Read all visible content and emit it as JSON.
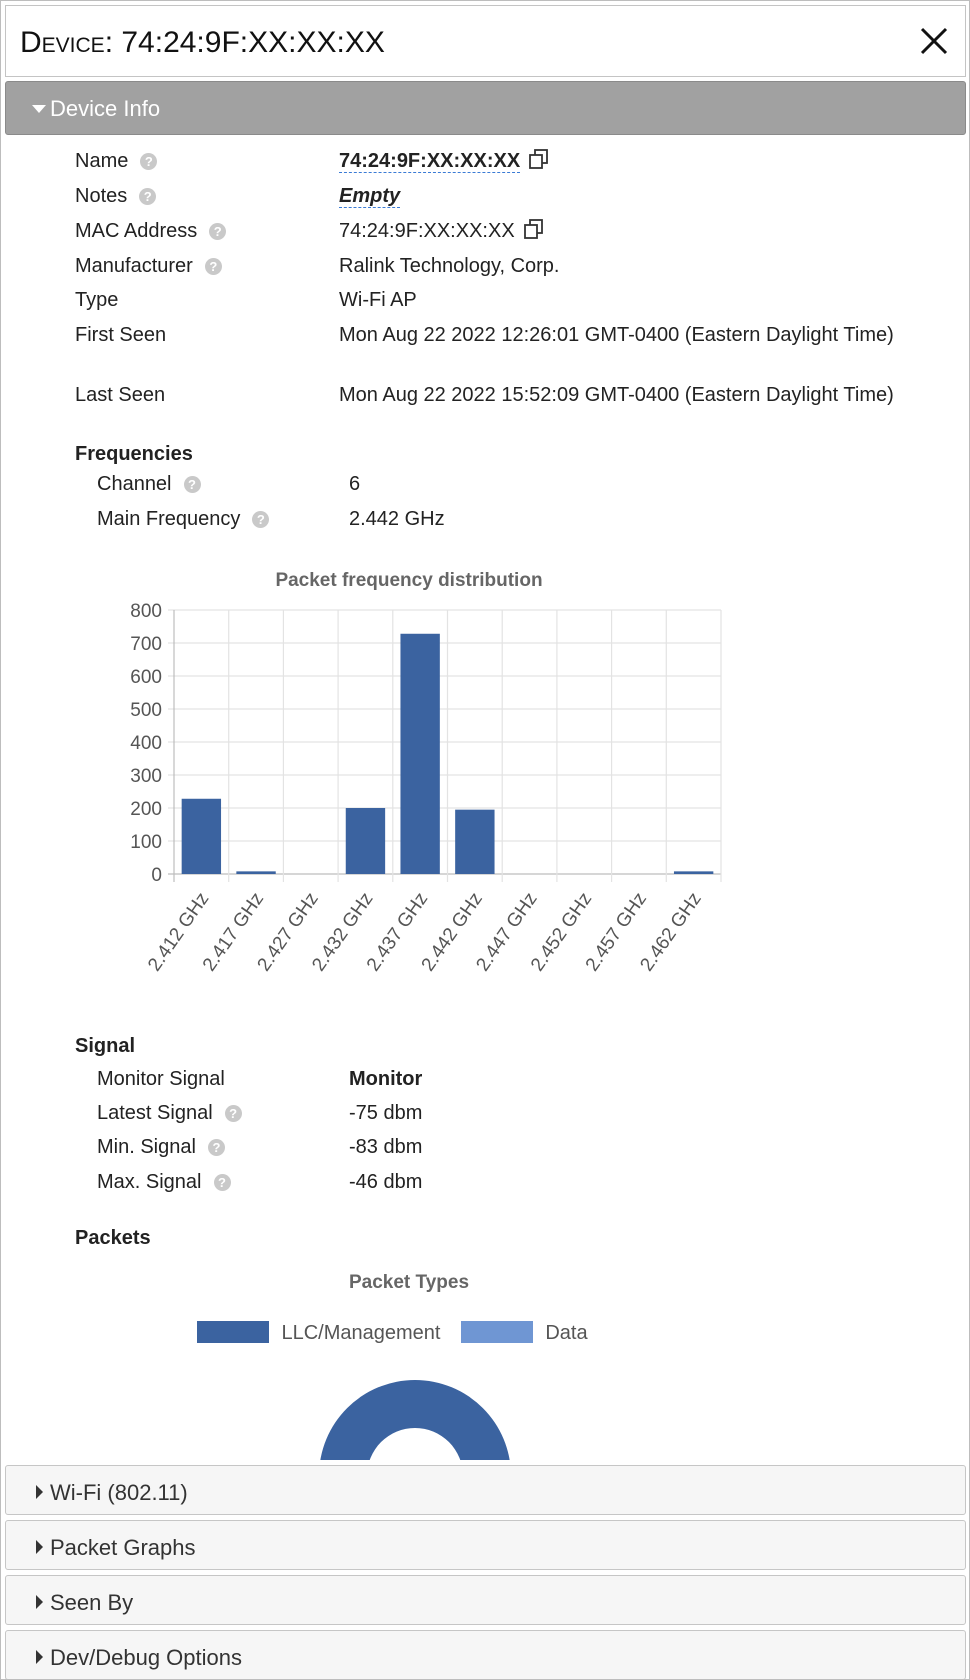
{
  "dialog": {
    "title_prefix": "Device",
    "title_value": "74:24:9F:XX:XX:XX"
  },
  "accordion": {
    "device_info": "Device Info",
    "wifi": "Wi-Fi (802.11)",
    "packet_graphs": "Packet Graphs",
    "seen_by": "Seen By",
    "dev_debug": "Dev/Debug Options"
  },
  "device_info": {
    "name_label": "Name",
    "name_value": "74:24:9F:XX:XX:XX",
    "notes_label": "Notes",
    "notes_value": "Empty",
    "mac_label": "MAC Address",
    "mac_value": "74:24:9F:XX:XX:XX",
    "manufacturer_label": "Manufacturer",
    "manufacturer_value": "Ralink Technology, Corp.",
    "type_label": "Type",
    "type_value": "Wi-Fi AP",
    "first_seen_label": "First Seen",
    "first_seen_value": "Mon Aug 22 2022 12:26:01 GMT-0400 (Eastern Daylight Time)",
    "last_seen_label": "Last Seen",
    "last_seen_value": "Mon Aug 22 2022 15:52:09 GMT-0400 (Eastern Daylight Time)"
  },
  "frequencies": {
    "heading": "Frequencies",
    "channel_label": "Channel",
    "channel_value": "6",
    "main_freq_label": "Main Frequency",
    "main_freq_value": "2.442 GHz"
  },
  "signal": {
    "heading": "Signal",
    "monitor_label": "Monitor Signal",
    "monitor_value": "Monitor",
    "latest_label": "Latest Signal",
    "latest_value": "-75 dbm",
    "min_label": "Min. Signal",
    "min_value": "-83 dbm",
    "max_label": "Max. Signal",
    "max_value": "-46 dbm"
  },
  "packets": {
    "heading": "Packets"
  },
  "colors": {
    "bar": "#3b63a0",
    "data_series": "#6f96d3",
    "header_active": "#a1a1a1"
  },
  "chart_data": [
    {
      "type": "bar",
      "title": "Packet frequency distribution",
      "categories": [
        "2.412 GHz",
        "2.417 GHz",
        "2.427 GHz",
        "2.432 GHz",
        "2.437 GHz",
        "2.442 GHz",
        "2.447 GHz",
        "2.452 GHz",
        "2.457 GHz",
        "2.462 GHz"
      ],
      "values": [
        228,
        8,
        0,
        200,
        728,
        195,
        0,
        0,
        0,
        8
      ],
      "ylim": [
        0,
        800
      ],
      "yticks": [
        0,
        100,
        200,
        300,
        400,
        500,
        600,
        700,
        800
      ],
      "grid": true,
      "xlabel": "",
      "ylabel": ""
    },
    {
      "type": "pie",
      "title": "Packet Types",
      "legend": [
        "LLC/Management",
        "Data"
      ],
      "legend_position": "top",
      "donut": true
    }
  ]
}
